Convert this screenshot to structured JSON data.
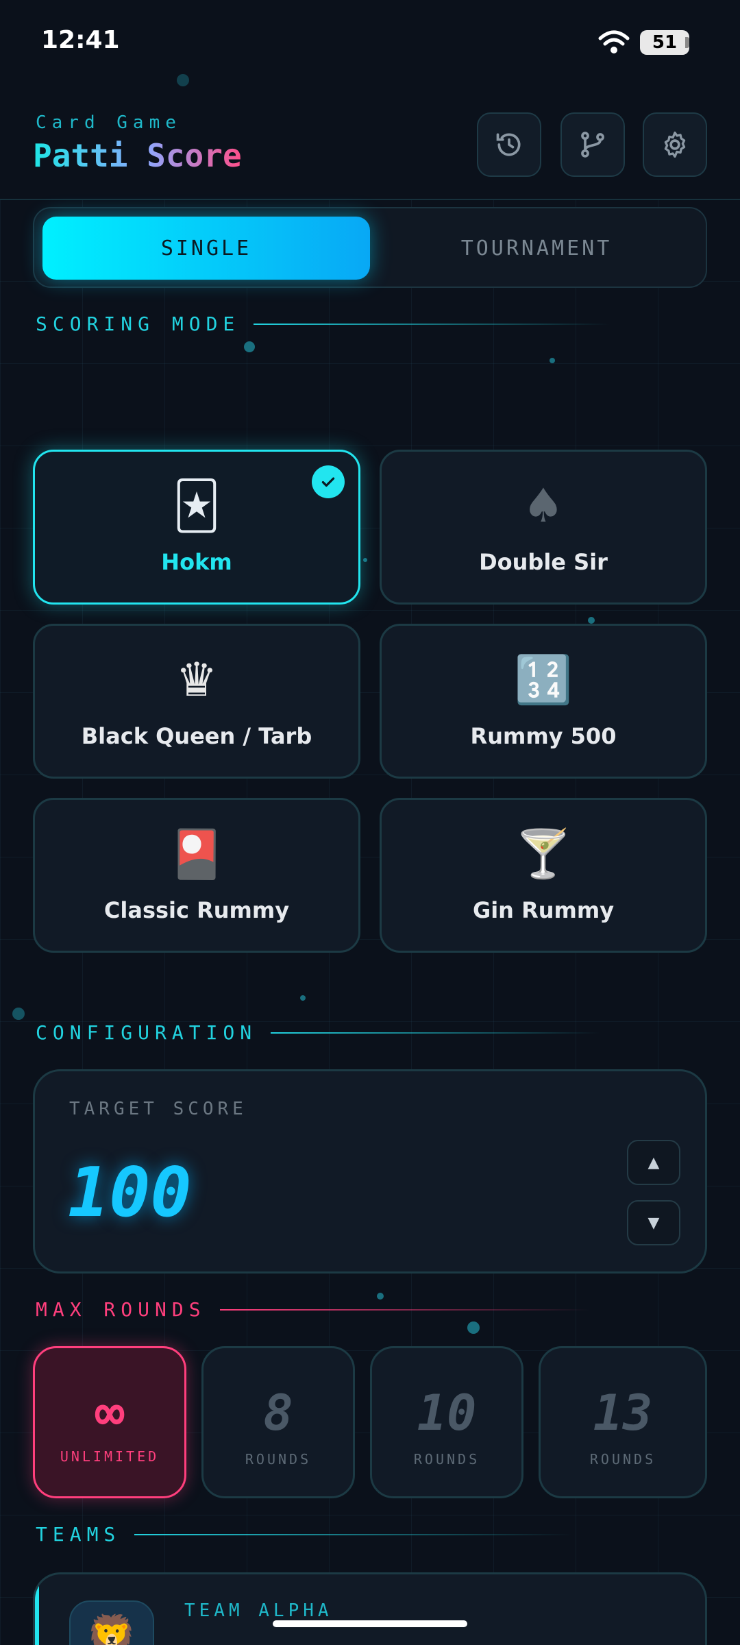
{
  "status": {
    "time": "12:41",
    "battery": "51"
  },
  "header": {
    "subtitle": "Card Game",
    "title": "Patti Score",
    "buttons": [
      "history-icon",
      "fork-icon",
      "gear-icon"
    ]
  },
  "tabs": {
    "single": "SINGLE",
    "tournament": "TOURNAMENT",
    "active": "single"
  },
  "scoring": {
    "title": "SCORING MODE",
    "modes": [
      {
        "label": "Hokm",
        "emoji": "🃏",
        "icon": "joker-card-icon",
        "selected": true
      },
      {
        "label": "Double Sir",
        "emoji": "♠️",
        "icon": "spade-icon",
        "selected": false
      },
      {
        "label": "Black Queen / Tarb",
        "emoji": "♛",
        "icon": "queen-icon",
        "selected": false
      },
      {
        "label": "Rummy 500",
        "emoji": "🔢",
        "icon": "numbers-icon",
        "selected": false
      },
      {
        "label": "Classic Rummy",
        "emoji": "🎴",
        "icon": "flower-card-icon",
        "selected": false
      },
      {
        "label": "Gin Rummy",
        "emoji": "🍸",
        "icon": "cocktail-icon",
        "selected": false
      }
    ]
  },
  "configuration": {
    "title": "CONFIGURATION",
    "target_label": "TARGET SCORE",
    "target_value": "100",
    "up": "▲",
    "down": "▼"
  },
  "max_rounds": {
    "title": "MAX ROUNDS",
    "options": [
      {
        "value": "∞",
        "sub": "UNLIMITED",
        "selected": true
      },
      {
        "value": "8",
        "sub": "ROUNDS",
        "selected": false
      },
      {
        "value": "10",
        "sub": "ROUNDS",
        "selected": false
      },
      {
        "value": "13",
        "sub": "ROUNDS",
        "selected": false
      }
    ]
  },
  "teams": {
    "title": "TEAMS",
    "first_team": "TEAM ALPHA",
    "first_avatar": "🦁"
  },
  "colors": {
    "accent": "#22e5ef",
    "pink": "#ff3f7d",
    "background": "#0b111b"
  }
}
